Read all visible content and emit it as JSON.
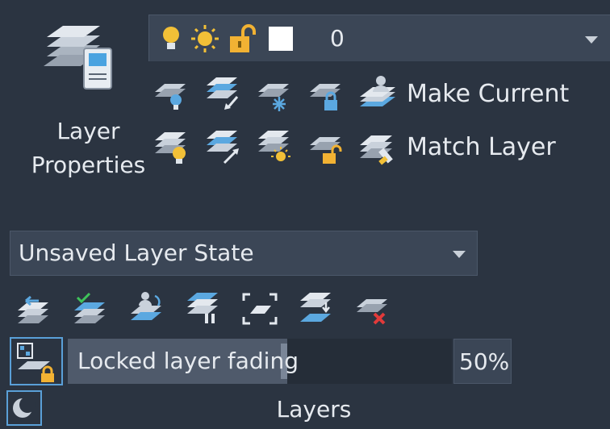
{
  "panel": {
    "title": "Layers"
  },
  "layer_properties": {
    "label_line1": "Layer",
    "label_line2": "Properties"
  },
  "layer_combo": {
    "current_layer": "0",
    "icons": [
      "bulb-on-icon",
      "sun-icon",
      "unlock-icon",
      "color-swatch-icon"
    ],
    "swatch_color": "#ffffff"
  },
  "toolbar_row1": {
    "icons": [
      "layer-off-icon",
      "layer-isolate-icon",
      "layer-freeze-icon",
      "layer-lock-icon",
      "make-current-icon"
    ],
    "make_current_label": "Make Current"
  },
  "toolbar_row2": {
    "icons": [
      "layer-on-icon",
      "layer-unisolate-icon",
      "layer-thaw-icon",
      "layer-unlock-icon",
      "match-layer-icon"
    ],
    "match_layer_label": "Match Layer"
  },
  "layer_state": {
    "value": "Unsaved Layer State"
  },
  "toolbar_row3": {
    "icons": [
      "previous-layer-icon",
      "change-to-current-icon",
      "copy-objects-icon",
      "layer-walk-icon",
      "isolate-to-current-viewport-icon",
      "merge-layer-icon",
      "delete-layer-icon"
    ]
  },
  "fading": {
    "label": "Locked layer fading",
    "percent": "50%",
    "level": 0.5
  },
  "colors": {
    "accent": "#5aa0d8",
    "bulb": "#f2c037",
    "lock": "#f2b233",
    "check": "#3fc35a",
    "cross": "#e23a3a",
    "layer_blue": "#5ba8e0"
  }
}
